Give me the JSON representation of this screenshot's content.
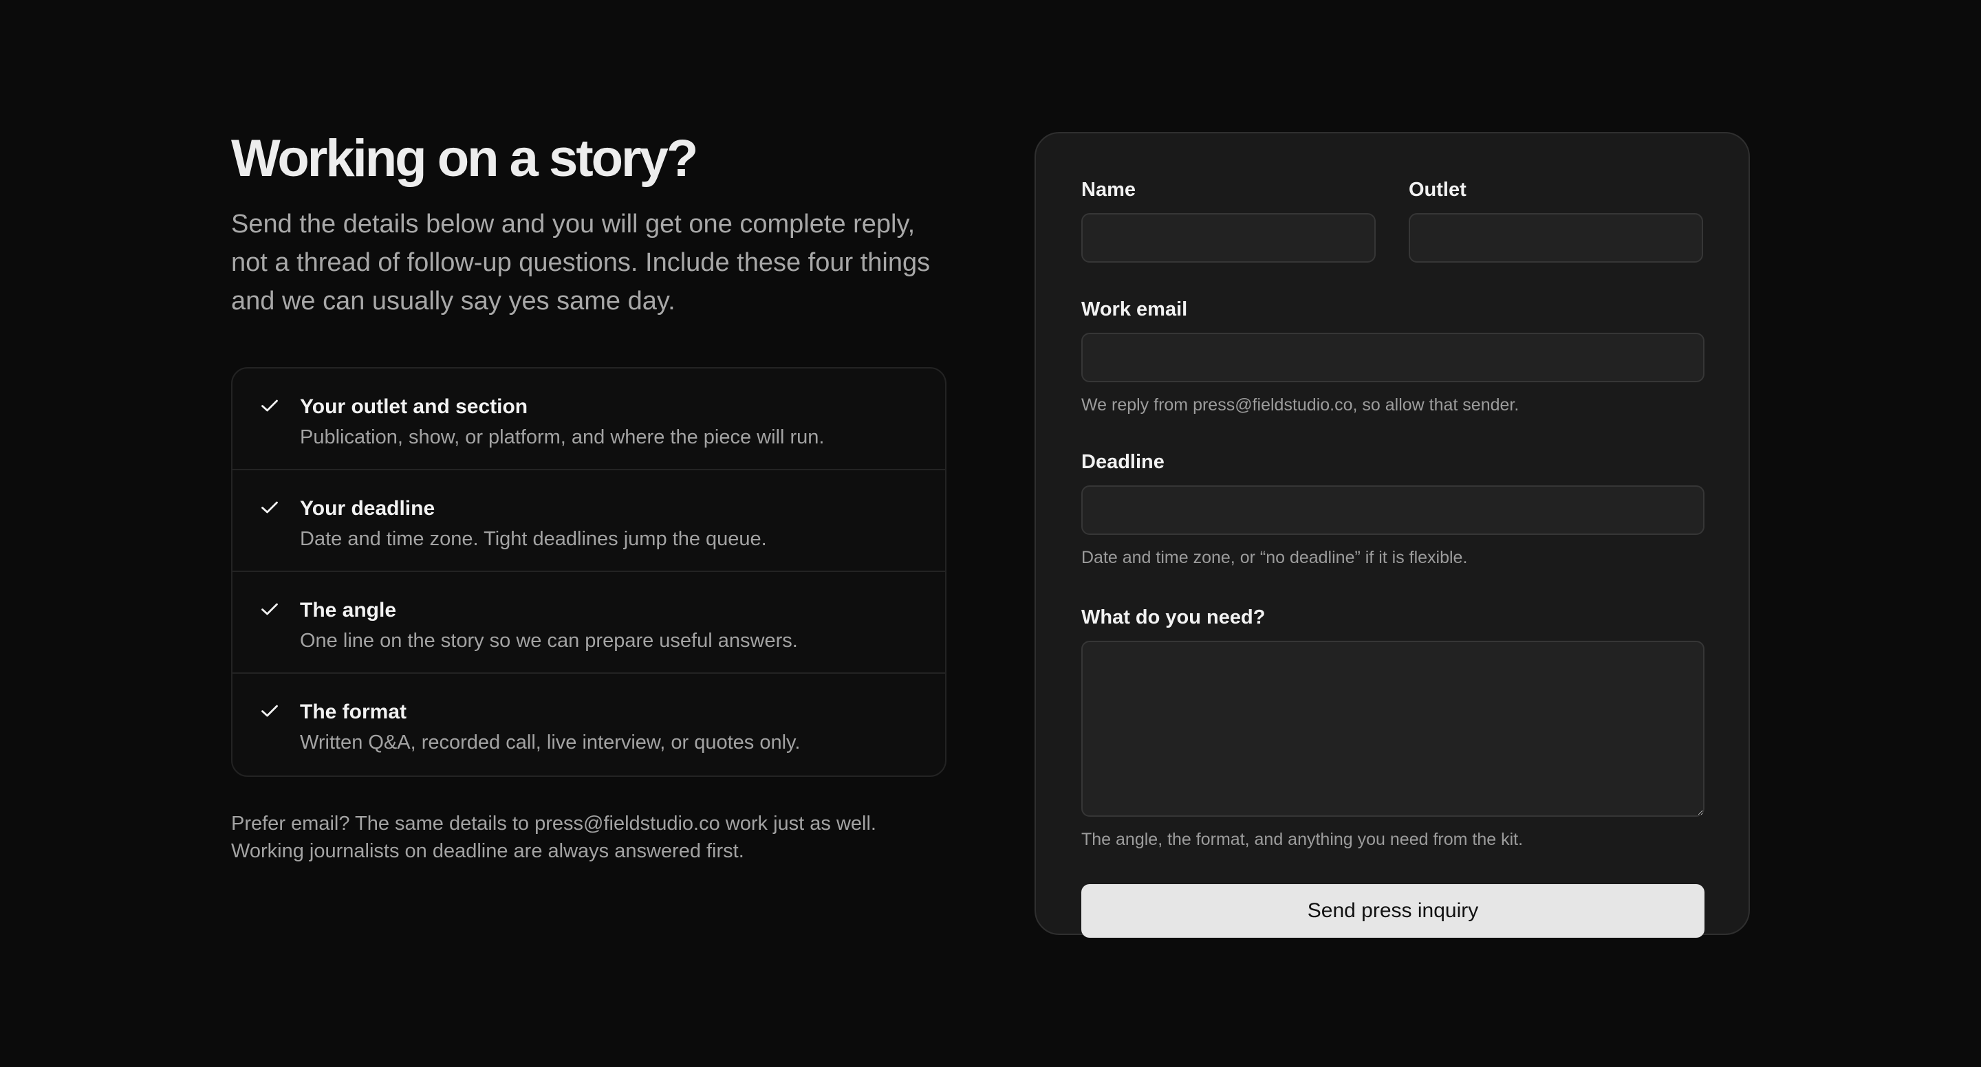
{
  "intro": {
    "title": "Working on a story?",
    "body": "Send the details below and you will get one complete reply, not a thread of follow-up questions. Include these four things and we can usually say yes same day."
  },
  "checklist": [
    {
      "title": "Your outlet and section",
      "description": "Publication, show, or platform, and where the piece will run."
    },
    {
      "title": "Your deadline",
      "description": "Date and time zone. Tight deadlines jump the queue."
    },
    {
      "title": "The angle",
      "description": "One line on the story so we can prepare useful answers."
    },
    {
      "title": "The format",
      "description": "Written Q&A, recorded call, live interview, or quotes only."
    }
  ],
  "footnote": {
    "line1": "Prefer email? The same details to press@fieldstudio.co work just as well.",
    "line2": "Working journalists on deadline are always answered first."
  },
  "form": {
    "name": {
      "label": "Name",
      "value": ""
    },
    "outlet": {
      "label": "Outlet",
      "value": ""
    },
    "email": {
      "label": "Work email",
      "value": "",
      "hint": "We reply from press@fieldstudio.co, so allow that sender."
    },
    "deadline": {
      "label": "Deadline",
      "value": "",
      "hint": "Date and time zone, or “no deadline” if it is flexible."
    },
    "need": {
      "label": "What do you need?",
      "value": "",
      "hint": "The angle, the format, and anything you need from the kit."
    },
    "submit_label": "Send press inquiry"
  },
  "colors": {
    "background": "#0b0b0b",
    "card": "#1a1a1a",
    "button": "#e6e6e6"
  },
  "icons": {
    "checklist": "check-icon"
  }
}
